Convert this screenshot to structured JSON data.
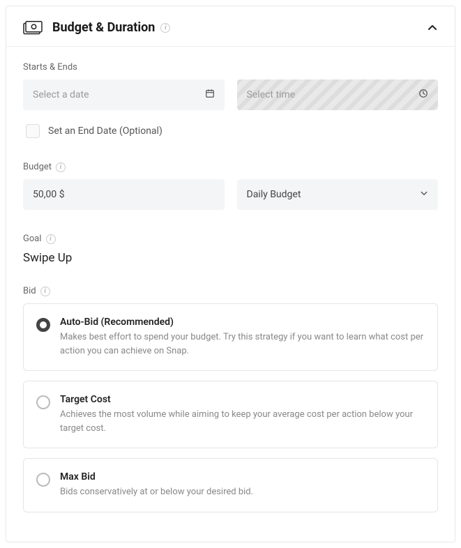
{
  "header": {
    "title": "Budget & Duration"
  },
  "startsEnds": {
    "label": "Starts & Ends",
    "datePlaceholder": "Select a date",
    "timePlaceholder": "Select time"
  },
  "endDate": {
    "label": "Set an End Date (Optional)"
  },
  "budget": {
    "label": "Budget",
    "amount": "50,00 $",
    "typeSelected": "Daily Budget"
  },
  "goal": {
    "label": "Goal",
    "value": "Swipe Up"
  },
  "bid": {
    "label": "Bid",
    "options": [
      {
        "title": "Auto-Bid (Recommended)",
        "desc": "Makes best effort to spend your budget. Try this strategy if you want to learn what cost per action you can achieve on Snap."
      },
      {
        "title": "Target Cost",
        "desc": "Achieves the most volume while aiming to keep your average cost per action below your target cost."
      },
      {
        "title": "Max Bid",
        "desc": "Bids conservatively at or below your desired bid."
      }
    ]
  }
}
